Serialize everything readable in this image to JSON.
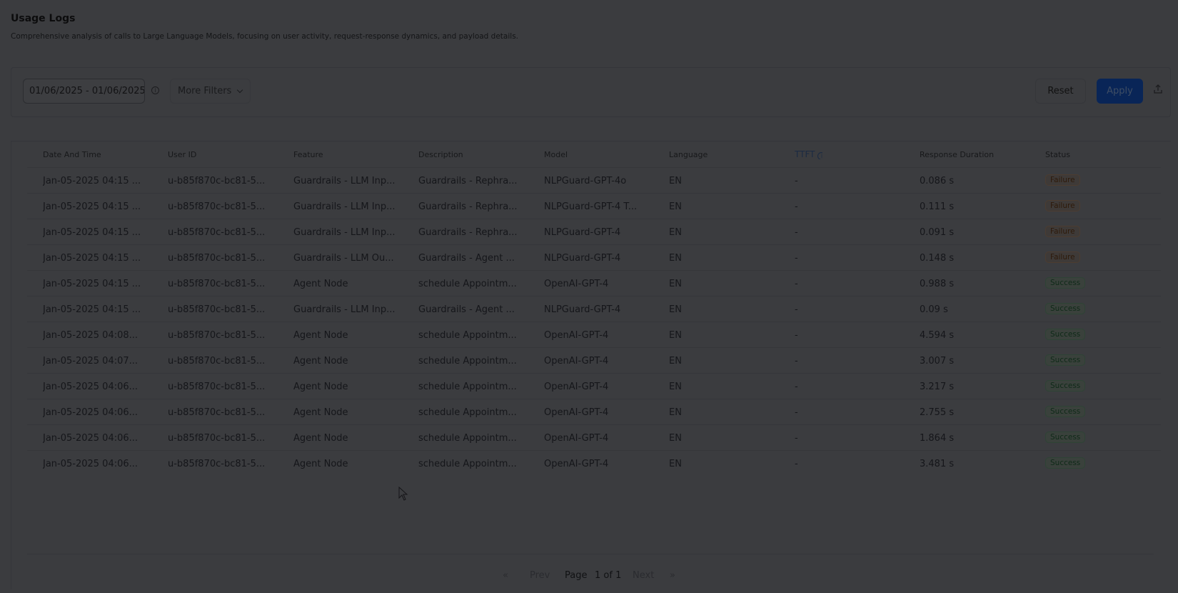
{
  "header": {
    "title": "Usage Logs",
    "subtitle": "Comprehensive analysis of calls to Large Language Models, focusing on user activity, request-response dynamics, and payload details."
  },
  "filters": {
    "date_range": "01/06/2025 - 01/06/2025",
    "more_filters_label": "More Filters",
    "reset_label": "Reset",
    "apply_label": "Apply"
  },
  "table": {
    "columns": [
      "Date And Time",
      "User ID",
      "Feature",
      "Description",
      "Model",
      "Language",
      "TTFT",
      "Response Duration",
      "Status"
    ],
    "rows": [
      {
        "date": "Jan-05-2025 04:15 ...",
        "user": "u-b85f870c-bc81-5...",
        "feature": "Guardrails - LLM Inp...",
        "description": "Guardrails - Rephra...",
        "model": "NLPGuard-GPT-4o",
        "language": "EN",
        "ttft": "-",
        "duration": "0.086 s",
        "status": "Failure"
      },
      {
        "date": "Jan-05-2025 04:15 ...",
        "user": "u-b85f870c-bc81-5...",
        "feature": "Guardrails - LLM Inp...",
        "description": "Guardrails - Rephra...",
        "model": "NLPGuard-GPT-4 T...",
        "language": "EN",
        "ttft": "-",
        "duration": "0.111 s",
        "status": "Failure"
      },
      {
        "date": "Jan-05-2025 04:15 ...",
        "user": "u-b85f870c-bc81-5...",
        "feature": "Guardrails - LLM Inp...",
        "description": "Guardrails - Rephra...",
        "model": "NLPGuard-GPT-4",
        "language": "EN",
        "ttft": "-",
        "duration": "0.091 s",
        "status": "Failure"
      },
      {
        "date": "Jan-05-2025 04:15 ...",
        "user": "u-b85f870c-bc81-5...",
        "feature": "Guardrails - LLM Ou...",
        "description": "Guardrails - Agent ...",
        "model": "NLPGuard-GPT-4",
        "language": "EN",
        "ttft": "-",
        "duration": "0.148 s",
        "status": "Failure"
      },
      {
        "date": "Jan-05-2025 04:15 ...",
        "user": "u-b85f870c-bc81-5...",
        "feature": "Agent Node",
        "description": "schedule Appointm...",
        "model": "OpenAI-GPT-4",
        "language": "EN",
        "ttft": "-",
        "duration": "0.988 s",
        "status": "Success"
      },
      {
        "date": "Jan-05-2025 04:15 ...",
        "user": "u-b85f870c-bc81-5...",
        "feature": "Guardrails - LLM Inp...",
        "description": "Guardrails - Agent ...",
        "model": "NLPGuard-GPT-4",
        "language": "EN",
        "ttft": "-",
        "duration": "0.09 s",
        "status": "Success"
      },
      {
        "date": "Jan-05-2025 04:08...",
        "user": "u-b85f870c-bc81-5...",
        "feature": "Agent Node",
        "description": "schedule Appointm...",
        "model": "OpenAI-GPT-4",
        "language": "EN",
        "ttft": "-",
        "duration": "4.594 s",
        "status": "Success"
      },
      {
        "date": "Jan-05-2025 04:07...",
        "user": "u-b85f870c-bc81-5...",
        "feature": "Agent Node",
        "description": "schedule Appointm...",
        "model": "OpenAI-GPT-4",
        "language": "EN",
        "ttft": "-",
        "duration": "3.007 s",
        "status": "Success"
      },
      {
        "date": "Jan-05-2025 04:06...",
        "user": "u-b85f870c-bc81-5...",
        "feature": "Agent Node",
        "description": "schedule Appointm...",
        "model": "OpenAI-GPT-4",
        "language": "EN",
        "ttft": "-",
        "duration": "3.217 s",
        "status": "Success"
      },
      {
        "date": "Jan-05-2025 04:06...",
        "user": "u-b85f870c-bc81-5...",
        "feature": "Agent Node",
        "description": "schedule Appointm...",
        "model": "OpenAI-GPT-4",
        "language": "EN",
        "ttft": "-",
        "duration": "2.755 s",
        "status": "Success"
      },
      {
        "date": "Jan-05-2025 04:06...",
        "user": "u-b85f870c-bc81-5...",
        "feature": "Agent Node",
        "description": "schedule Appointm...",
        "model": "OpenAI-GPT-4",
        "language": "EN",
        "ttft": "-",
        "duration": "1.864 s",
        "status": "Success"
      },
      {
        "date": "Jan-05-2025 04:06...",
        "user": "u-b85f870c-bc81-5...",
        "feature": "Agent Node",
        "description": "schedule Appointm...",
        "model": "OpenAI-GPT-4",
        "language": "EN",
        "ttft": "-",
        "duration": "3.481 s",
        "status": "Success"
      }
    ]
  },
  "pagination": {
    "first": "«",
    "prev": "Prev",
    "page_label": "Page",
    "page_value": "1 of 1",
    "next": "Next",
    "last": "»"
  },
  "colors": {
    "overlay_background": "#3b3c3f",
    "apply_button": "#092557",
    "failure_badge": "#2e1a0a",
    "success_badge": "#0f2a18"
  }
}
